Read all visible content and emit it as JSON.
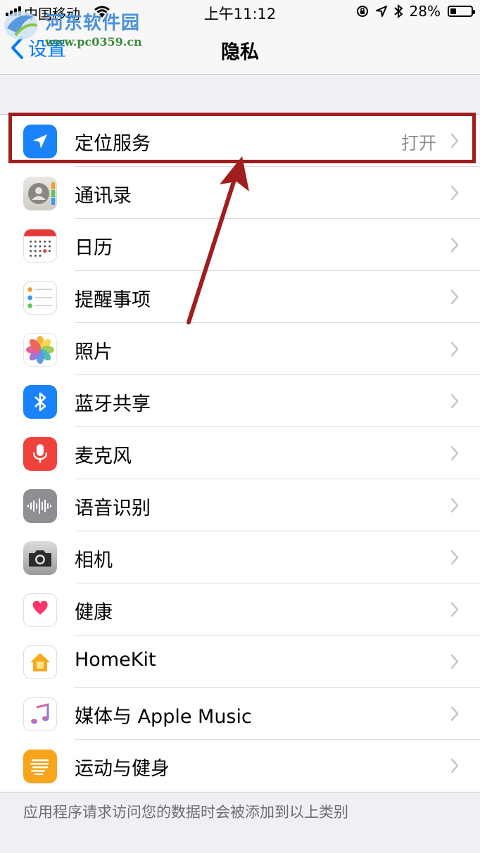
{
  "status_bar": {
    "carrier": "中国移动",
    "time": "上午11:12",
    "battery": "28%",
    "battery_level": 0.28
  },
  "watermark": {
    "title": "河东软件园",
    "url": "www.pc0359.cn"
  },
  "nav": {
    "back_label": "设置",
    "title": "隐私"
  },
  "rows": [
    {
      "label": "定位服务",
      "value": "打开",
      "icon": "location-arrow-icon"
    },
    {
      "label": "通讯录",
      "value": "",
      "icon": "contacts-icon"
    },
    {
      "label": "日历",
      "value": "",
      "icon": "calendar-icon"
    },
    {
      "label": "提醒事项",
      "value": "",
      "icon": "reminders-icon"
    },
    {
      "label": "照片",
      "value": "",
      "icon": "photos-icon"
    },
    {
      "label": "蓝牙共享",
      "value": "",
      "icon": "bluetooth-icon"
    },
    {
      "label": "麦克风",
      "value": "",
      "icon": "microphone-icon"
    },
    {
      "label": "语音识别",
      "value": "",
      "icon": "speech-recognition-icon"
    },
    {
      "label": "相机",
      "value": "",
      "icon": "camera-icon"
    },
    {
      "label": "健康",
      "value": "",
      "icon": "health-icon"
    },
    {
      "label": "HomeKit",
      "value": "",
      "icon": "homekit-icon"
    },
    {
      "label": "媒体与 Apple Music",
      "value": "",
      "icon": "music-icon"
    },
    {
      "label": "运动与健身",
      "value": "",
      "icon": "motion-fitness-icon"
    }
  ],
  "footer_note": "应用程序请求访问您的数据时会被添加到以上类别",
  "colors": {
    "accent": "#007aff",
    "highlight": "#a01e1e",
    "background": "#efeff4"
  }
}
